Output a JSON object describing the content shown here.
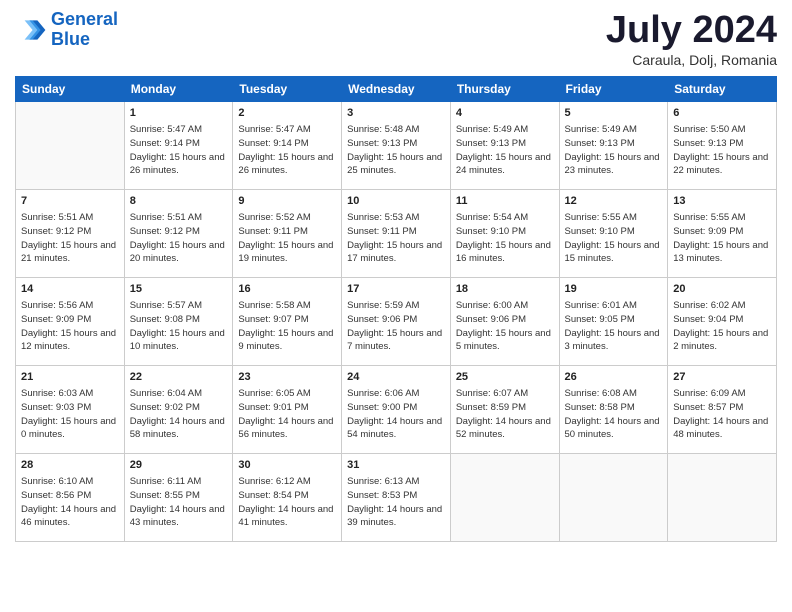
{
  "header": {
    "logo_line1": "General",
    "logo_line2": "Blue",
    "month_title": "July 2024",
    "location": "Caraula, Dolj, Romania"
  },
  "weekdays": [
    "Sunday",
    "Monday",
    "Tuesday",
    "Wednesday",
    "Thursday",
    "Friday",
    "Saturday"
  ],
  "weeks": [
    [
      {
        "day": "",
        "sunrise": "",
        "sunset": "",
        "daylight": ""
      },
      {
        "day": "1",
        "sunrise": "Sunrise: 5:47 AM",
        "sunset": "Sunset: 9:14 PM",
        "daylight": "Daylight: 15 hours and 26 minutes."
      },
      {
        "day": "2",
        "sunrise": "Sunrise: 5:47 AM",
        "sunset": "Sunset: 9:14 PM",
        "daylight": "Daylight: 15 hours and 26 minutes."
      },
      {
        "day": "3",
        "sunrise": "Sunrise: 5:48 AM",
        "sunset": "Sunset: 9:13 PM",
        "daylight": "Daylight: 15 hours and 25 minutes."
      },
      {
        "day": "4",
        "sunrise": "Sunrise: 5:49 AM",
        "sunset": "Sunset: 9:13 PM",
        "daylight": "Daylight: 15 hours and 24 minutes."
      },
      {
        "day": "5",
        "sunrise": "Sunrise: 5:49 AM",
        "sunset": "Sunset: 9:13 PM",
        "daylight": "Daylight: 15 hours and 23 minutes."
      },
      {
        "day": "6",
        "sunrise": "Sunrise: 5:50 AM",
        "sunset": "Sunset: 9:13 PM",
        "daylight": "Daylight: 15 hours and 22 minutes."
      }
    ],
    [
      {
        "day": "7",
        "sunrise": "Sunrise: 5:51 AM",
        "sunset": "Sunset: 9:12 PM",
        "daylight": "Daylight: 15 hours and 21 minutes."
      },
      {
        "day": "8",
        "sunrise": "Sunrise: 5:51 AM",
        "sunset": "Sunset: 9:12 PM",
        "daylight": "Daylight: 15 hours and 20 minutes."
      },
      {
        "day": "9",
        "sunrise": "Sunrise: 5:52 AM",
        "sunset": "Sunset: 9:11 PM",
        "daylight": "Daylight: 15 hours and 19 minutes."
      },
      {
        "day": "10",
        "sunrise": "Sunrise: 5:53 AM",
        "sunset": "Sunset: 9:11 PM",
        "daylight": "Daylight: 15 hours and 17 minutes."
      },
      {
        "day": "11",
        "sunrise": "Sunrise: 5:54 AM",
        "sunset": "Sunset: 9:10 PM",
        "daylight": "Daylight: 15 hours and 16 minutes."
      },
      {
        "day": "12",
        "sunrise": "Sunrise: 5:55 AM",
        "sunset": "Sunset: 9:10 PM",
        "daylight": "Daylight: 15 hours and 15 minutes."
      },
      {
        "day": "13",
        "sunrise": "Sunrise: 5:55 AM",
        "sunset": "Sunset: 9:09 PM",
        "daylight": "Daylight: 15 hours and 13 minutes."
      }
    ],
    [
      {
        "day": "14",
        "sunrise": "Sunrise: 5:56 AM",
        "sunset": "Sunset: 9:09 PM",
        "daylight": "Daylight: 15 hours and 12 minutes."
      },
      {
        "day": "15",
        "sunrise": "Sunrise: 5:57 AM",
        "sunset": "Sunset: 9:08 PM",
        "daylight": "Daylight: 15 hours and 10 minutes."
      },
      {
        "day": "16",
        "sunrise": "Sunrise: 5:58 AM",
        "sunset": "Sunset: 9:07 PM",
        "daylight": "Daylight: 15 hours and 9 minutes."
      },
      {
        "day": "17",
        "sunrise": "Sunrise: 5:59 AM",
        "sunset": "Sunset: 9:06 PM",
        "daylight": "Daylight: 15 hours and 7 minutes."
      },
      {
        "day": "18",
        "sunrise": "Sunrise: 6:00 AM",
        "sunset": "Sunset: 9:06 PM",
        "daylight": "Daylight: 15 hours and 5 minutes."
      },
      {
        "day": "19",
        "sunrise": "Sunrise: 6:01 AM",
        "sunset": "Sunset: 9:05 PM",
        "daylight": "Daylight: 15 hours and 3 minutes."
      },
      {
        "day": "20",
        "sunrise": "Sunrise: 6:02 AM",
        "sunset": "Sunset: 9:04 PM",
        "daylight": "Daylight: 15 hours and 2 minutes."
      }
    ],
    [
      {
        "day": "21",
        "sunrise": "Sunrise: 6:03 AM",
        "sunset": "Sunset: 9:03 PM",
        "daylight": "Daylight: 15 hours and 0 minutes."
      },
      {
        "day": "22",
        "sunrise": "Sunrise: 6:04 AM",
        "sunset": "Sunset: 9:02 PM",
        "daylight": "Daylight: 14 hours and 58 minutes."
      },
      {
        "day": "23",
        "sunrise": "Sunrise: 6:05 AM",
        "sunset": "Sunset: 9:01 PM",
        "daylight": "Daylight: 14 hours and 56 minutes."
      },
      {
        "day": "24",
        "sunrise": "Sunrise: 6:06 AM",
        "sunset": "Sunset: 9:00 PM",
        "daylight": "Daylight: 14 hours and 54 minutes."
      },
      {
        "day": "25",
        "sunrise": "Sunrise: 6:07 AM",
        "sunset": "Sunset: 8:59 PM",
        "daylight": "Daylight: 14 hours and 52 minutes."
      },
      {
        "day": "26",
        "sunrise": "Sunrise: 6:08 AM",
        "sunset": "Sunset: 8:58 PM",
        "daylight": "Daylight: 14 hours and 50 minutes."
      },
      {
        "day": "27",
        "sunrise": "Sunrise: 6:09 AM",
        "sunset": "Sunset: 8:57 PM",
        "daylight": "Daylight: 14 hours and 48 minutes."
      }
    ],
    [
      {
        "day": "28",
        "sunrise": "Sunrise: 6:10 AM",
        "sunset": "Sunset: 8:56 PM",
        "daylight": "Daylight: 14 hours and 46 minutes."
      },
      {
        "day": "29",
        "sunrise": "Sunrise: 6:11 AM",
        "sunset": "Sunset: 8:55 PM",
        "daylight": "Daylight: 14 hours and 43 minutes."
      },
      {
        "day": "30",
        "sunrise": "Sunrise: 6:12 AM",
        "sunset": "Sunset: 8:54 PM",
        "daylight": "Daylight: 14 hours and 41 minutes."
      },
      {
        "day": "31",
        "sunrise": "Sunrise: 6:13 AM",
        "sunset": "Sunset: 8:53 PM",
        "daylight": "Daylight: 14 hours and 39 minutes."
      },
      {
        "day": "",
        "sunrise": "",
        "sunset": "",
        "daylight": ""
      },
      {
        "day": "",
        "sunrise": "",
        "sunset": "",
        "daylight": ""
      },
      {
        "day": "",
        "sunrise": "",
        "sunset": "",
        "daylight": ""
      }
    ]
  ]
}
